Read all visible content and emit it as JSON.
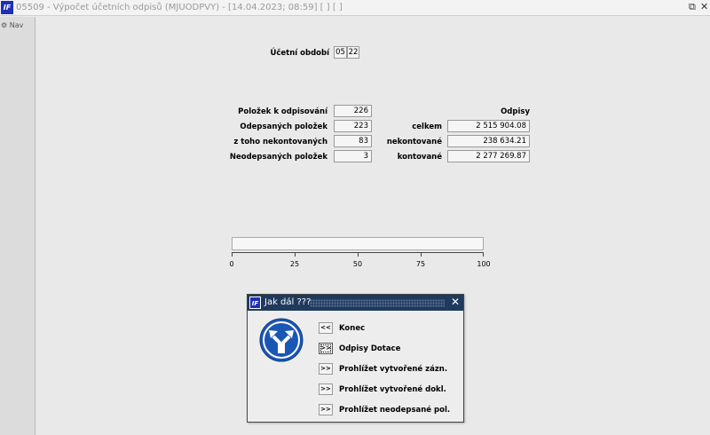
{
  "window": {
    "title": "05509 - Výpočet účetních odpisů (MJUODPVY) - [14.04.2023; 08:59]  [ ] [ ]",
    "app_icon": "IF",
    "restore_icon": "⧉",
    "close_icon": "✕"
  },
  "sidebar": {
    "nav_label": "Nav",
    "nav_icon": "⚙"
  },
  "period": {
    "label": "Účetní období",
    "month": "05",
    "year": "22"
  },
  "counts": {
    "to_depreciate_label": "Položek k odpisování",
    "to_depreciate": "226",
    "depreciated_label": "Odepsaných položek",
    "depreciated": "223",
    "not_posted_label": "z toho nekontovaných",
    "not_posted": "83",
    "not_depreciated_label": "Neodepsaných položek",
    "not_depreciated": "3"
  },
  "depreciation": {
    "header": "Odpisy",
    "total_label": "celkem",
    "total": "2 515 904.08",
    "not_posted_label": "nekontované",
    "not_posted": "238 634.21",
    "posted_label": "kontované",
    "posted": "2 277 269.87"
  },
  "progress": {
    "value": 0,
    "ticks": [
      "0",
      "25",
      "50",
      "75",
      "100"
    ]
  },
  "dialog": {
    "title": "Jak dál ???",
    "icon": "IF",
    "close_icon": "✕",
    "sign_icon": "road-fork-sign-icon",
    "sign_color": "#1a56b5",
    "buttons": [
      {
        "symbol": "<<",
        "label": "Konec"
      },
      {
        "symbol": ">>",
        "label": "Odpisy Dotace"
      },
      {
        "symbol": ">>",
        "label": "Prohlížet vytvořené zázn."
      },
      {
        "symbol": ">>",
        "label": "Prohlížet vytvořené dokl."
      },
      {
        "symbol": ">>",
        "label": "Prohlížet neodepsané pol."
      }
    ]
  }
}
